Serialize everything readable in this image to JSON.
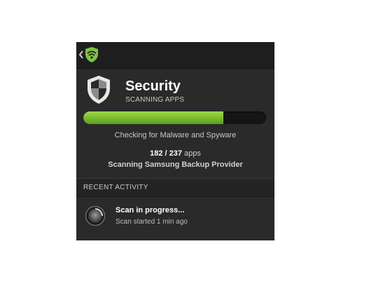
{
  "actionbar": {
    "back_icon": "chevron-left-icon",
    "app_icon": "lookout-wifi-shield-icon",
    "accent_color": "#7dc242"
  },
  "header": {
    "icon": "shield-icon",
    "title": "Security",
    "subtitle": "SCANNING APPS"
  },
  "progress": {
    "fraction": 0.7679,
    "fill_color": "#7dc242"
  },
  "status": {
    "text": "Checking for Malware and Spyware",
    "scanned": "182",
    "separator": " / ",
    "total": "237",
    "unit": " apps",
    "current_item": "Scanning Samsung Backup Provider"
  },
  "recent_activity": {
    "header": "RECENT ACTIVITY",
    "items": [
      {
        "icon": "spinner-icon",
        "title": "Scan in progress...",
        "subtitle": "Scan started 1 min ago"
      }
    ]
  }
}
